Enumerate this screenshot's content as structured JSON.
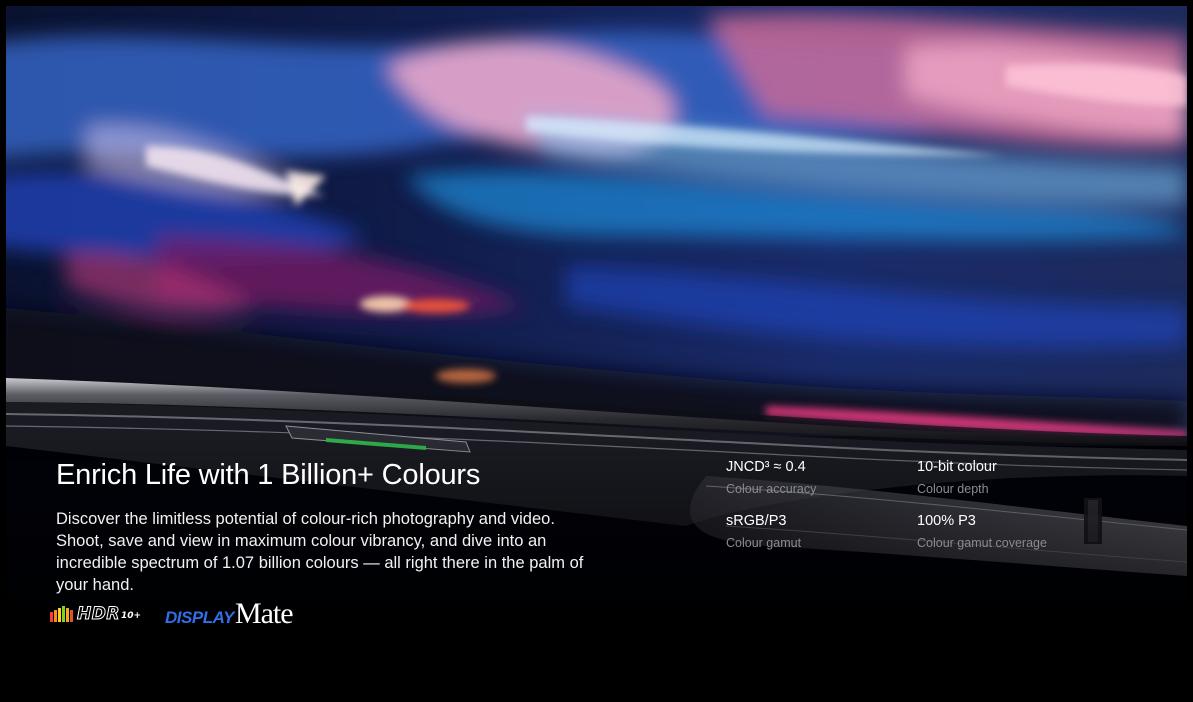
{
  "hero": {
    "headline": "Enrich Life with 1 Billion+ Colours",
    "description": "Discover the limitless potential of colour-rich photography and video. Shoot, save and view in maximum colour vibrancy, and dive into an incredible spectrum of 1.07 billion colours — all right there in the palm of your hand."
  },
  "logos": {
    "hdr_main": "HDR",
    "hdr_sub": "10+",
    "displaymate_display": "DISPLAY",
    "displaymate_mate": "Mate"
  },
  "specs": [
    {
      "value": "JNCD³ ≈ 0.4",
      "label": "Colour accuracy"
    },
    {
      "value": "10-bit colour",
      "label": "Colour depth"
    },
    {
      "value": "sRGB/P3",
      "label": "Colour gamut"
    },
    {
      "value": "100% P3",
      "label": "Colour gamut coverage"
    }
  ],
  "colors": {
    "background": "#000000",
    "text_primary": "#ffffff",
    "text_secondary": "#8b8b90",
    "displaymate_blue": "#2f6fe8",
    "volume_key_green": "#2fae4a"
  }
}
